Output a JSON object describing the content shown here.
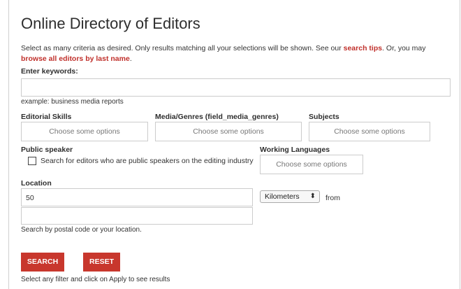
{
  "header": {
    "title": "Online Directory of Editors"
  },
  "intro": {
    "text_before": "Select as many criteria as desired. Only results matching all your selections will be shown. See our ",
    "search_tips": "search tips",
    "text_middle": ". Or, you may ",
    "browse_link": "browse all editors by last name",
    "text_after": "."
  },
  "keywords": {
    "label": "Enter keywords:",
    "value": "",
    "example": "example: business media reports"
  },
  "filters": {
    "editorial_skills": {
      "label": "Editorial Skills",
      "placeholder": "Choose some options"
    },
    "media_genres": {
      "label": "Media/Genres (field_media_genres)",
      "placeholder": "Choose some options"
    },
    "subjects": {
      "label": "Subjects",
      "placeholder": "Choose some options"
    }
  },
  "public_speaker": {
    "label": "Public speaker",
    "checkbox_label": "Search for editors who are public speakers on the editing industry",
    "checked": false
  },
  "working_languages": {
    "label": "Working Languages",
    "placeholder": "Choose some options"
  },
  "location": {
    "label": "Location",
    "distance_value": "50",
    "unit_selected": "Kilometers",
    "unit_arrow": "⬍",
    "from_label": "from",
    "postal_value": "",
    "help": "Search by postal code or your location."
  },
  "buttons": {
    "search": "SEARCH",
    "reset": "RESET"
  },
  "footer_note": "Select any filter and click on Apply to see results",
  "colors": {
    "accent": "#c8372d",
    "link": "#c0302b"
  }
}
